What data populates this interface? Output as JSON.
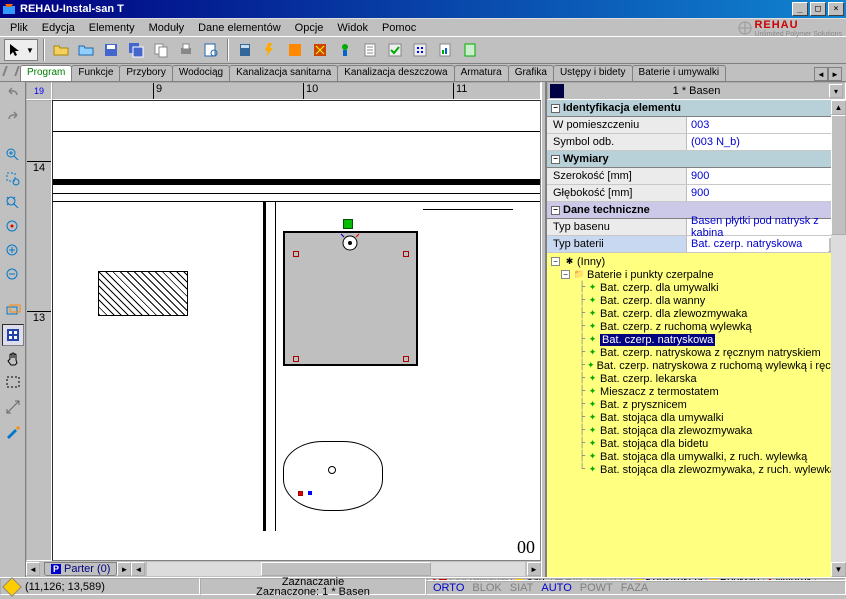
{
  "window": {
    "title": "REHAU-Instal-san T"
  },
  "brand": {
    "name": "REHAU",
    "sub": "Unlimited Polymer Solutions"
  },
  "menu": {
    "file": "Plik",
    "edit": "Edycja",
    "elements": "Elementy",
    "modules": "Moduły",
    "element_data": "Dane elementów",
    "options": "Opcje",
    "view": "Widok",
    "help": "Pomoc"
  },
  "tabs_top": {
    "program": "Program",
    "funkcje": "Funkcje",
    "przybory": "Przybory",
    "wodociag": "Wodociąg",
    "kan_san": "Kanalizacja sanitarna",
    "kan_desz": "Kanalizacja deszczowa",
    "armatura": "Armatura",
    "grafika": "Grafika",
    "ustepy": "Ustępy i bidety",
    "baterie": "Baterie i umywalki"
  },
  "ruler": {
    "corner": "19",
    "h_9": "9",
    "h_10": "10",
    "h_11": "11",
    "v_14": "14",
    "v_13": "13"
  },
  "floor_tab": {
    "label": "Parter (0)"
  },
  "properties": {
    "title": "1 * Basen",
    "sec_ident": "Identyfikacja elementu",
    "room_label": "W pomieszczeniu",
    "room_val": "003",
    "symbol_label": "Symbol odb.",
    "symbol_val": "(003 N_b)",
    "sec_dim": "Wymiary",
    "width_label": "Szerokość [mm]",
    "width_val": "900",
    "depth_label": "Głębokość [mm]",
    "depth_val": "900",
    "sec_tech": "Dane techniczne",
    "basin_type_label": "Typ basenu",
    "basin_type_val": "Basen płytki pod natrysk z kabiną",
    "bat_type_label": "Typ baterii",
    "bat_type_val": "Bat. czerp. natryskowa"
  },
  "tree": {
    "root_inny": "(Inny)",
    "root_bip": "Baterie i punkty czerpalne",
    "i1": "Bat. czerp. dla umywalki",
    "i2": "Bat. czerp. dla wanny",
    "i3": "Bat. czerp. dla zlewozmywaka",
    "i4": "Bat. czerp. z ruchomą wylewką",
    "i5": "Bat. czerp. natryskowa",
    "i6": "Bat. czerp. natryskowa z ręcznym natryskiem",
    "i7": "Bat. czerp. natryskowa z ruchomą wylewką i ręcznym na",
    "i8": "Bat. czerp. lekarska",
    "i9": "Mieszacz z termostatem",
    "i10": "Bat. z prysznicem",
    "i11": "Bat. stojąca dla umywalki",
    "i12": "Bat. stojąca dla zlewozmywaka",
    "i13": "Bat. stojąca dla bidetu",
    "i14": "Bat. stojąca dla umywalki, z ruch. wylewką",
    "i15": "Bat. stojąca dla zlewozmywaka, z ruch. wylewką"
  },
  "status": {
    "coords": "(11,126; 13,589)",
    "mode1": "Zaznaczanie",
    "mode2": "Zaznaczone: 1 * Basen",
    "mini": {
      "ogrz": "Ogrzewanie",
      "san": "San.",
      "rys": "Rys.pętli o.p.",
      "konstr": "Konstrukcja",
      "podklad": "Podkład",
      "wydruk": "Wydruk"
    },
    "modes": {
      "orto": "ORTO",
      "blok": "BLOK",
      "siat": "SIAT",
      "auto": "AUTO",
      "powt": "POWT",
      "faza": "FAZA"
    }
  },
  "canvas_label_00": "00"
}
